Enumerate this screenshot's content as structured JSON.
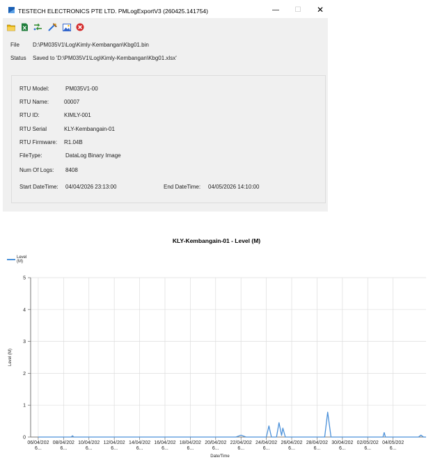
{
  "window": {
    "title": "TESTECH ELECTRONICS PTE LTD.  PMLogExportV3 (260425.141754)",
    "min_glyph": "—",
    "max_glyph": "☐",
    "close_glyph": "✕"
  },
  "toolbar": {
    "buttons": [
      {
        "name": "open-folder-icon",
        "color": "#e8b400"
      },
      {
        "name": "export-excel-icon",
        "color": "#1e7d3a"
      },
      {
        "name": "convert-icon",
        "color": "#2e8b2e"
      },
      {
        "name": "tools-icon",
        "color": "#2a6fd6"
      },
      {
        "name": "image-icon",
        "color": "#3366cc"
      },
      {
        "name": "cancel-icon",
        "color": "#d42a2a"
      }
    ]
  },
  "file_row": {
    "label": "File",
    "value": "D:\\PM035V1\\Log\\Kimly-Kembangan\\Kbg01.bin"
  },
  "status_row": {
    "label": "Status",
    "value": "Saved to 'D:\\PM035V1\\Log\\Kimly-Kembangan\\Kbg01.xlsx'"
  },
  "info": {
    "rtu_model_label": "RTU Model:",
    "rtu_model": "PM035V1-00",
    "rtu_name_label": "RTU Name:",
    "rtu_name": "00007",
    "rtu_id_label": "RTU ID:",
    "rtu_id": "KIMLY-001",
    "rtu_serial_label": "RTU Serial",
    "rtu_serial": "KLY-Kembangain-01",
    "rtu_firmware_label": "RTU Firmware:",
    "rtu_firmware": "R1.04B",
    "file_type_label": "FileType:",
    "file_type": "DataLog Binary Image",
    "num_logs_label": "Num Of Logs:",
    "num_logs": "8408",
    "start_label": "Start DateTime:",
    "start": "04/04/2026 23:13:00",
    "end_label": "End DateTime:",
    "end": "04/05/2026 14:10:00"
  },
  "chart_data": {
    "type": "line",
    "title": "KLY-Kembangain-01  - Level (M)",
    "xlabel": "Date/Time",
    "ylabel": "Level (M)",
    "ylim": [
      0,
      5
    ],
    "yticks": [
      0,
      1,
      2,
      3,
      4,
      5
    ],
    "grid": true,
    "legend_position": "top-left",
    "line_color": "#4a90d9",
    "series": [
      {
        "name_line1": "Level",
        "name_line2": "(M)",
        "points": [
          [
            0.0,
            0.0
          ],
          [
            1.3,
            0.0
          ],
          [
            1.35,
            0.04
          ],
          [
            1.4,
            0.0
          ],
          [
            7.8,
            0.0
          ],
          [
            8.0,
            0.06
          ],
          [
            8.2,
            0.0
          ],
          [
            9.0,
            0.0
          ],
          [
            9.1,
            0.35
          ],
          [
            9.2,
            0.0
          ],
          [
            9.4,
            0.0
          ],
          [
            9.5,
            0.45
          ],
          [
            9.6,
            0.05
          ],
          [
            9.65,
            0.28
          ],
          [
            9.75,
            0.0
          ],
          [
            11.3,
            0.0
          ],
          [
            11.42,
            0.78
          ],
          [
            11.55,
            0.0
          ],
          [
            13.6,
            0.0
          ],
          [
            13.65,
            0.14
          ],
          [
            13.7,
            0.0
          ],
          [
            15.0,
            0.0
          ],
          [
            15.1,
            0.06
          ],
          [
            15.2,
            0.0
          ],
          [
            15.3,
            0.0
          ]
        ]
      }
    ],
    "xticks": [
      {
        "x": 0,
        "l1": "06/04/202",
        "l2": "6..."
      },
      {
        "x": 1,
        "l1": "08/04/202",
        "l2": "6..."
      },
      {
        "x": 2,
        "l1": "10/04/202",
        "l2": "6..."
      },
      {
        "x": 3,
        "l1": "12/04/202",
        "l2": "6..."
      },
      {
        "x": 4,
        "l1": "14/04/202",
        "l2": "6..."
      },
      {
        "x": 5,
        "l1": "16/04/202",
        "l2": "6..."
      },
      {
        "x": 6,
        "l1": "18/04/202",
        "l2": "6..."
      },
      {
        "x": 7,
        "l1": "20/04/202",
        "l2": "6..."
      },
      {
        "x": 8,
        "l1": "22/04/202",
        "l2": "6..."
      },
      {
        "x": 9,
        "l1": "24/04/202",
        "l2": "6..."
      },
      {
        "x": 10,
        "l1": "26/04/202",
        "l2": "6..."
      },
      {
        "x": 11,
        "l1": "28/04/202",
        "l2": "6..."
      },
      {
        "x": 12,
        "l1": "30/04/202",
        "l2": "6..."
      },
      {
        "x": 13,
        "l1": "02/05/202",
        "l2": "6..."
      },
      {
        "x": 14,
        "l1": "04/05/202",
        "l2": "6..."
      }
    ]
  }
}
